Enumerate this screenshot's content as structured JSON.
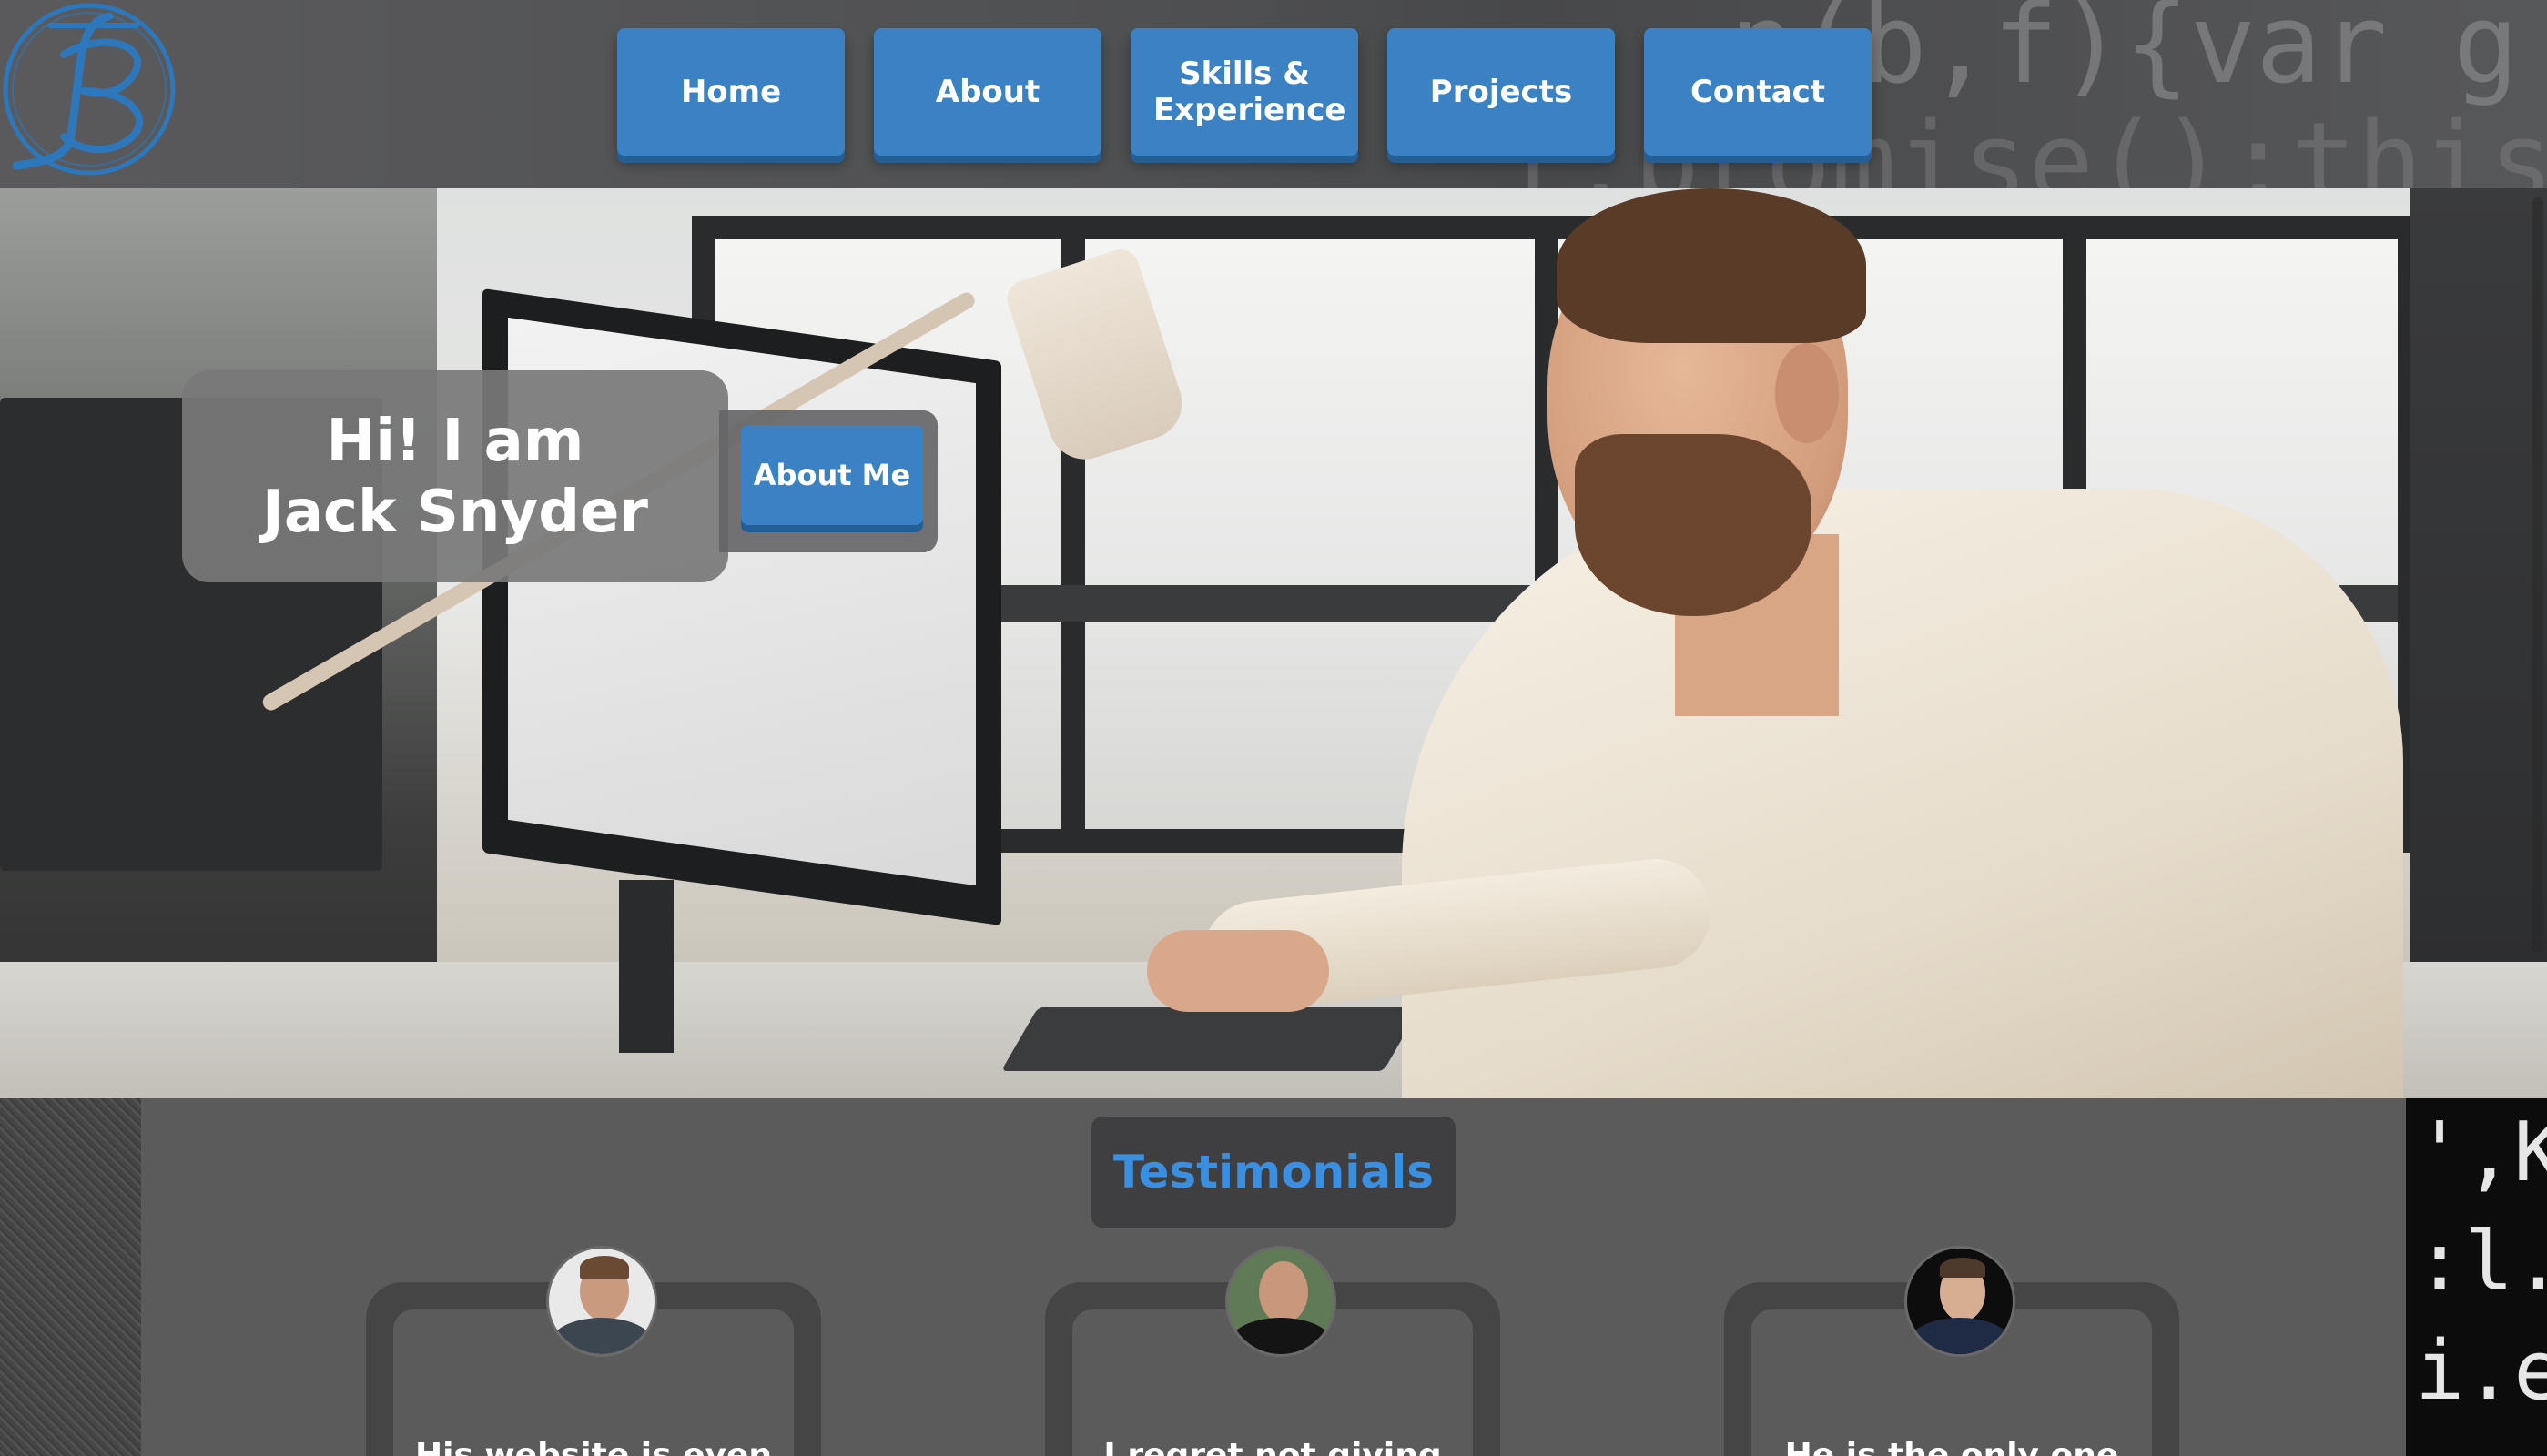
{
  "brand": {
    "logo_name": "JS monogram logo"
  },
  "nav": {
    "items": [
      {
        "label": "Home"
      },
      {
        "label": "About"
      },
      {
        "label": "Skills & Experience"
      },
      {
        "label": "Projects"
      },
      {
        "label": "Contact"
      }
    ]
  },
  "header_code_text": {
    "line1": "n(b,f){var g",
    "line2": "f.promise();this.e"
  },
  "hero": {
    "intro_line1": "Hi! I am",
    "intro_line2": "Jack Snyder",
    "about_button": "About Me"
  },
  "testimonials": {
    "title": "Testimonials",
    "cards": [
      {
        "quote": "His website is even"
      },
      {
        "quote": "I regret not giving"
      },
      {
        "quote": "He is the only one"
      }
    ]
  },
  "side_code_text": {
    "line1": "',K",
    "line2": ":l.",
    "line3": "i.e."
  },
  "colors": {
    "accent_blue": "#3b82c4",
    "title_blue": "#3b8fe0",
    "panel_gray": "#5b5b5c"
  }
}
